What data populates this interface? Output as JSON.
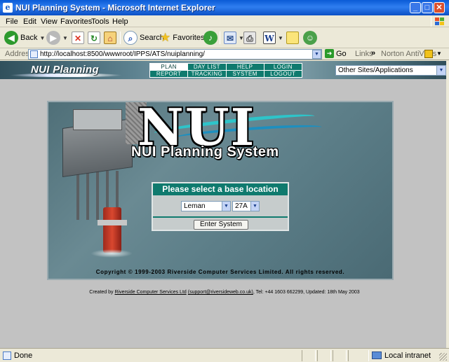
{
  "window": {
    "title": "NUI Planning System - Microsoft Internet Explorer",
    "icon_glyph": "e",
    "min_glyph": "_",
    "max_glyph": "□",
    "close_glyph": "✕"
  },
  "menubar": {
    "items": [
      "File",
      "Edit",
      "View",
      "Favorites",
      "Tools",
      "Help"
    ]
  },
  "toolbar": {
    "back_label": "Back",
    "search_label": "Search",
    "favorites_label": "Favorites"
  },
  "addressbar": {
    "label": "Address",
    "url": "http://localhost:8500/wwwroot/IPPS/ATS/nuiplanning/",
    "go_label": "Go",
    "links_label": "Links",
    "links_chevron": "»",
    "norton_label": "Norton AntiVirus"
  },
  "banner": {
    "title": "NUI Planning",
    "nav": [
      {
        "label": "PLAN",
        "active": true
      },
      {
        "label": "DAY LIST",
        "active": false
      },
      {
        "label": "HELP",
        "active": false
      },
      {
        "label": "LOGIN",
        "active": false
      },
      {
        "label": "REPORT",
        "active": false
      },
      {
        "label": "TRACKING",
        "active": false
      },
      {
        "label": "SYSTEM",
        "active": false
      },
      {
        "label": "LOGOUT",
        "active": false
      }
    ],
    "sites_select": "Other Sites/Applications"
  },
  "panel": {
    "logo_text": "NUI",
    "system_title": "NUI Planning System",
    "selector_heading": "Please select a base location",
    "base_value": "Leman",
    "field_value": "27A",
    "enter_button": "Enter System",
    "copyright": "Copyright © 1999-2003 Riverside Computer Services Limited. All rights reserved."
  },
  "footer": {
    "prefix": "Created by ",
    "company_link": "Riverside Computer Services Ltd",
    "email_link": "(support@riversideweb.co.uk)",
    "suffix": ", Tel: +44 1603 662299, Updated: 18th May 2003"
  },
  "statusbar": {
    "status": "Done",
    "zone": "Local intranet"
  },
  "colors": {
    "nav_teal": "#0f7a6e",
    "xp_blue": "#0a5bd6",
    "content_gray": "#c2c2c2"
  }
}
